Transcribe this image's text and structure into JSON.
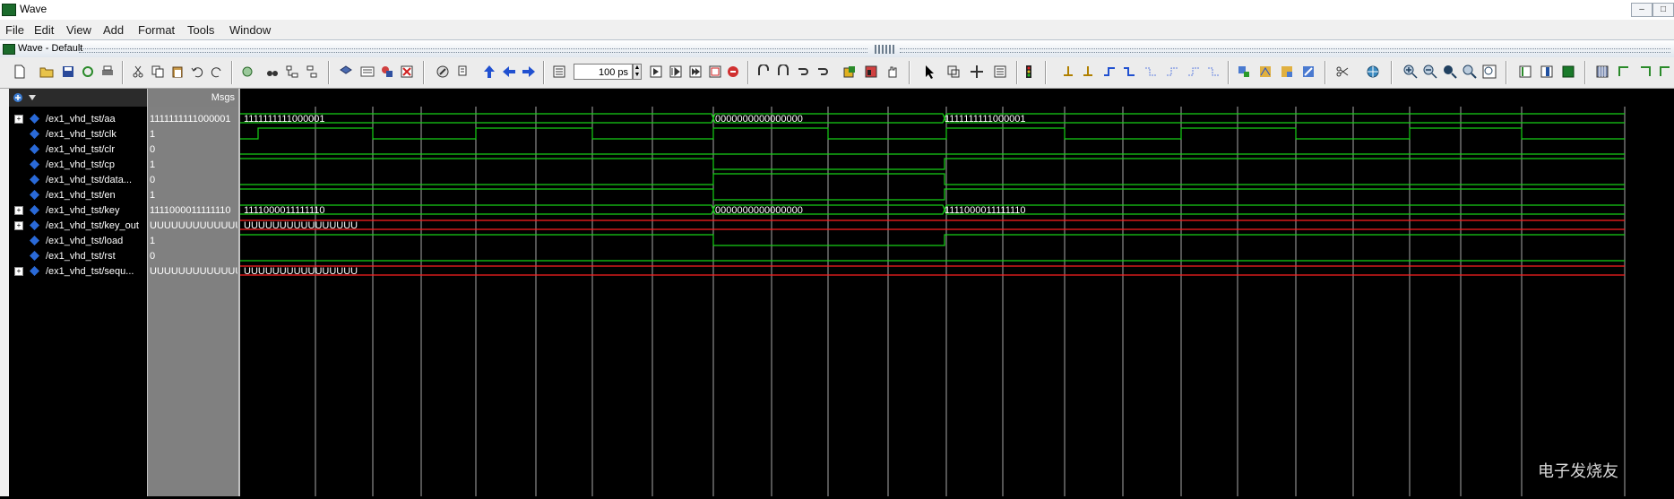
{
  "window": {
    "title": "Wave",
    "min": "–",
    "max": "□"
  },
  "menu": [
    "File",
    "Edit",
    "View",
    "Add",
    "Format",
    "Tools",
    "Window"
  ],
  "inner_title": "Wave - Default",
  "toolbar": {
    "zoom_value": "100 ps",
    "spin_up": "▲",
    "spin_down": "▼"
  },
  "panes": {
    "msgs_header": "Msgs"
  },
  "signals": [
    {
      "name": "/ex1_vhd_tst/aa",
      "value": "1111111111000001",
      "expandable": true,
      "expander": "+"
    },
    {
      "name": "/ex1_vhd_tst/clk",
      "value": "1",
      "expandable": false
    },
    {
      "name": "/ex1_vhd_tst/clr",
      "value": "0",
      "expandable": false
    },
    {
      "name": "/ex1_vhd_tst/cp",
      "value": "1",
      "expandable": false
    },
    {
      "name": "/ex1_vhd_tst/data...",
      "value": "0",
      "expandable": false
    },
    {
      "name": "/ex1_vhd_tst/en",
      "value": "1",
      "expandable": false
    },
    {
      "name": "/ex1_vhd_tst/key",
      "value": "1111000011111110",
      "expandable": true,
      "expander": "+"
    },
    {
      "name": "/ex1_vhd_tst/key_out",
      "value": "UUUUUUUUUUUUUUUU",
      "expandable": true,
      "expander": "+"
    },
    {
      "name": "/ex1_vhd_tst/load",
      "value": "1",
      "expandable": false
    },
    {
      "name": "/ex1_vhd_tst/rst",
      "value": "0",
      "expandable": false
    },
    {
      "name": "/ex1_vhd_tst/sequ...",
      "value": "UUUUUUUUUUUUUUUU",
      "expandable": true,
      "expander": "+"
    }
  ],
  "bus_labels": {
    "aa": [
      "1111111111000001",
      "0000000000000000",
      "1111111111000001"
    ],
    "key": [
      "1111000011111110",
      "0000000000000000",
      "1111000011111110"
    ],
    "key_out": [
      "UUUUUUUUUUUUUUUU"
    ],
    "sequ": [
      "UUUUUUUUUUUUUUUU"
    ]
  },
  "colors": {
    "wave_green": "#16d016",
    "wave_red": "#ff2020",
    "grid": "#a8a8a8",
    "bus_text": "#ffffff"
  },
  "watermark": "电子发烧友"
}
